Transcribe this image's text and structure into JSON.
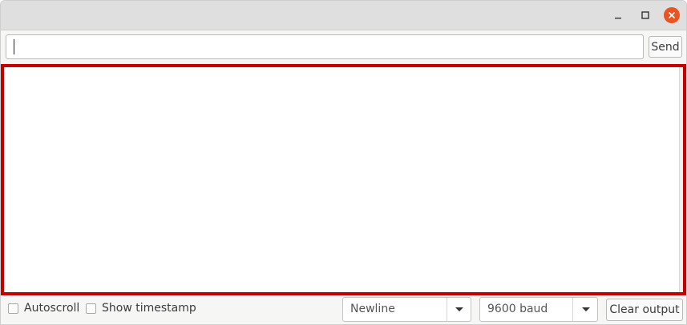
{
  "window": {
    "controls": {
      "minimize_icon": "minimize-icon",
      "maximize_icon": "maximize-icon",
      "close_icon": "close-icon",
      "close_color": "#e95420"
    }
  },
  "send_bar": {
    "input_value": "",
    "send_label": "Send"
  },
  "output": {
    "text": "",
    "border_color": "#c50000"
  },
  "bottom_bar": {
    "autoscroll": {
      "label": "Autoscroll",
      "checked": false
    },
    "show_timestamp": {
      "label": "Show timestamp",
      "checked": false
    },
    "line_ending": {
      "selected": "Newline"
    },
    "baud_rate": {
      "selected": "9600 baud"
    },
    "clear_label": "Clear output"
  }
}
